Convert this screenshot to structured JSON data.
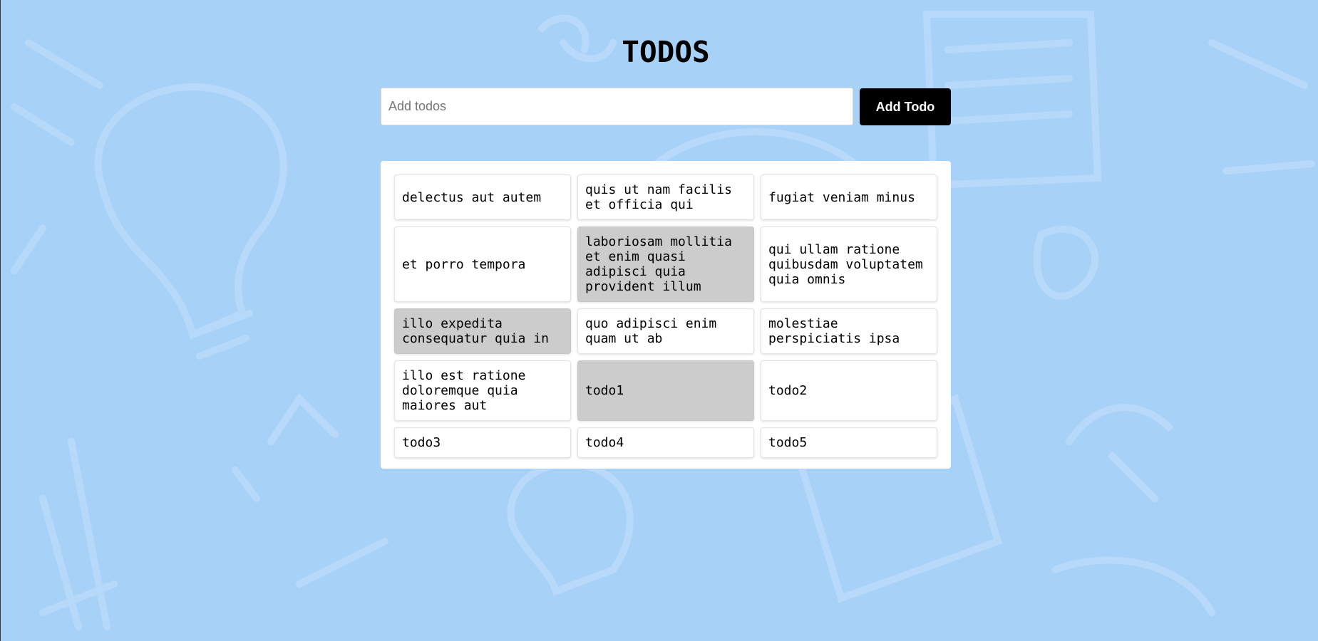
{
  "app": {
    "title": "TODOS"
  },
  "input": {
    "value": "",
    "placeholder": "Add todos"
  },
  "add_button": {
    "label": "Add Todo"
  },
  "colors": {
    "background": "#a8d1f7",
    "button": "#000000",
    "completed_card": "#cccccc"
  },
  "todos": [
    {
      "text": "delectus aut autem",
      "completed": false
    },
    {
      "text": "quis ut nam facilis et officia qui",
      "completed": false
    },
    {
      "text": "fugiat veniam minus",
      "completed": false
    },
    {
      "text": "et porro tempora",
      "completed": false
    },
    {
      "text": "laboriosam mollitia et enim quasi adipisci quia provident illum",
      "completed": true
    },
    {
      "text": "qui ullam ratione quibusdam voluptatem quia omnis",
      "completed": false
    },
    {
      "text": "illo expedita consequatur quia in",
      "completed": true
    },
    {
      "text": "quo adipisci enim quam ut ab",
      "completed": false
    },
    {
      "text": "molestiae perspiciatis ipsa",
      "completed": false
    },
    {
      "text": "illo est ratione doloremque quia maiores aut",
      "completed": false
    },
    {
      "text": "todo1",
      "completed": true
    },
    {
      "text": "todo2",
      "completed": false
    },
    {
      "text": "todo3",
      "completed": false
    },
    {
      "text": "todo4",
      "completed": false
    },
    {
      "text": "todo5",
      "completed": false
    }
  ]
}
